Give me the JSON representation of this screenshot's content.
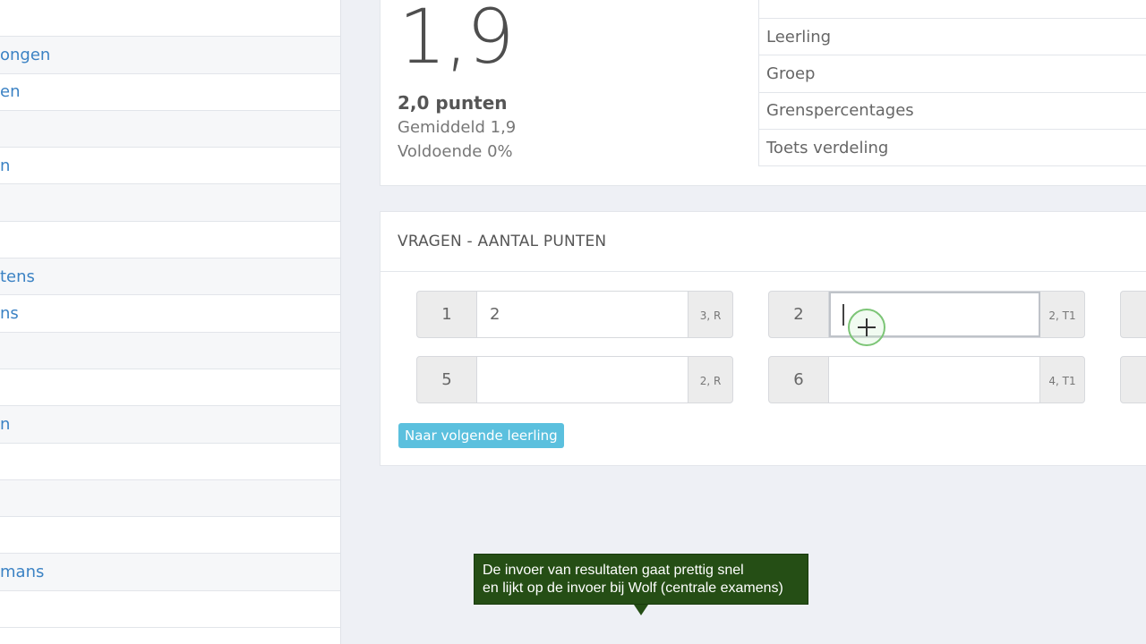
{
  "sidebar": {
    "items": [
      {
        "label": ""
      },
      {
        "label": "ongen"
      },
      {
        "label": "en"
      },
      {
        "label": ""
      },
      {
        "label": "n"
      },
      {
        "label": ""
      },
      {
        "label": ""
      },
      {
        "label": "tens"
      },
      {
        "label": "ns"
      },
      {
        "label": ""
      },
      {
        "label": ""
      },
      {
        "label": "n"
      },
      {
        "label": ""
      },
      {
        "label": ""
      },
      {
        "label": ""
      },
      {
        "label": "mans"
      },
      {
        "label": ""
      }
    ]
  },
  "summary": {
    "grade": "1,9",
    "points": "2,0 punten",
    "average": "Gemiddeld 1,9",
    "passing": "Voldoende 0%"
  },
  "menu": {
    "items": [
      "Leerling",
      "Groep",
      "Grenspercentages",
      "Toets verdeling"
    ]
  },
  "questions": {
    "header": "VRAGEN - AANTAL PUNTEN",
    "items": [
      {
        "number": "1",
        "value": "2",
        "meta": "3, R"
      },
      {
        "number": "2",
        "value": "",
        "meta": "2, T1"
      },
      {
        "number": "5",
        "value": "",
        "meta": "2, R"
      },
      {
        "number": "6",
        "value": "",
        "meta": "4, T1"
      }
    ],
    "next_button": "Naar volgende leerling"
  },
  "tooltip": {
    "line1": "De invoer van resultaten gaat prettig snel",
    "line2": "en lijkt op de invoer bij Wolf (centrale examens)"
  }
}
